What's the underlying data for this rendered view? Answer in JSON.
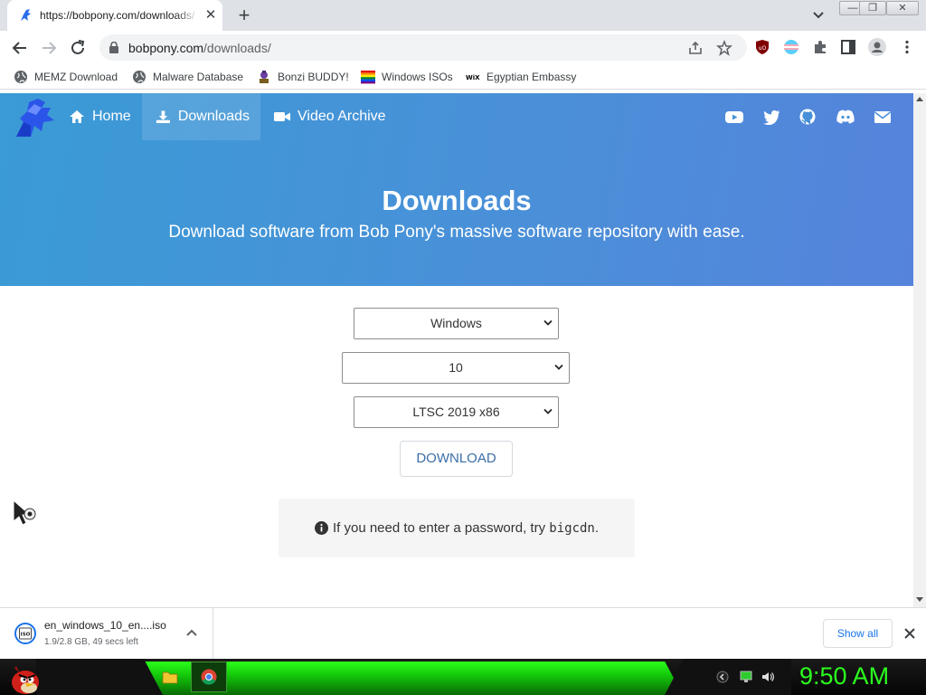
{
  "browser": {
    "tab_title": "https://bobpony.com/downloads/",
    "url_host": "bobpony.com",
    "url_path": "/downloads/",
    "bookmarks": [
      {
        "label": "MEMZ Download"
      },
      {
        "label": "Malware Database"
      },
      {
        "label": "Bonzi BUDDY!"
      },
      {
        "label": "Windows ISOs"
      },
      {
        "label": "Egyptian Embassy"
      }
    ]
  },
  "site": {
    "nav": [
      {
        "label": "Home",
        "icon": "home-icon"
      },
      {
        "label": "Downloads",
        "icon": "download-icon"
      },
      {
        "label": "Video Archive",
        "icon": "video-icon"
      }
    ],
    "social_icons": [
      "youtube-icon",
      "twitter-icon",
      "github-icon",
      "discord-icon",
      "mail-icon"
    ],
    "hero_title": "Downloads",
    "hero_subtitle": "Download software from Bob Pony's massive software repository with ease.",
    "select_os": "Windows",
    "select_version": "10",
    "select_edition": "LTSC 2019 x86",
    "download_label": "DOWNLOAD",
    "notice_text": "If you need to enter a password, try ",
    "notice_code": "bigcdn",
    "notice_end": ".",
    "colors": {
      "hero_start": "#3a9bd6",
      "hero_end": "#5583dc",
      "button_text": "#3b6ea5"
    }
  },
  "download_shelf": {
    "file_name": "en_windows_10_en....iso",
    "status": "1.9/2.8 GB, 49 secs left",
    "show_all_label": "Show all"
  },
  "taskbar": {
    "clock": "9:50 AM",
    "accent": "#2bff1f"
  }
}
